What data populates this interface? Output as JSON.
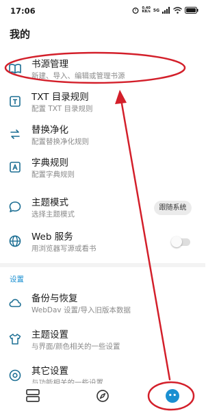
{
  "status_bar": {
    "time": "17:06",
    "net_speed_value": "0.40",
    "net_speed_unit": "KB/s",
    "signal_label": "5G"
  },
  "page": {
    "title": "我的"
  },
  "items": [
    {
      "title": "书源管理",
      "subtitle": "新建、导入、编辑或管理书源",
      "icon": "book-icon"
    },
    {
      "title": "TXT 目录规则",
      "subtitle": "配置 TXT 目录规则",
      "icon": "t-box-icon"
    },
    {
      "title": "替换净化",
      "subtitle": "配置替换净化规则",
      "icon": "swap-icon"
    },
    {
      "title": "字典规则",
      "subtitle": "配置字典规则",
      "icon": "a-box-icon"
    },
    {
      "title": "主题模式",
      "subtitle": "选择主题模式",
      "icon": "speech-bubble-icon",
      "button_label": "跟随系统"
    },
    {
      "title": "Web 服务",
      "subtitle": "用浏览器写源或看书",
      "icon": "globe-icon",
      "toggle_on": false
    }
  ],
  "settings_section": {
    "label": "设置",
    "items": [
      {
        "title": "备份与恢复",
        "subtitle": "WebDav 设置/导入旧版本数据",
        "icon": "cloud-icon"
      },
      {
        "title": "主题设置",
        "subtitle": "与界面/颜色相关的一些设置",
        "icon": "tshirt-icon"
      },
      {
        "title": "其它设置",
        "subtitle": "与功能相关的一些设置",
        "icon": "eye-icon"
      }
    ]
  },
  "bottom_nav": {
    "items": [
      {
        "icon": "bookshelf-icon",
        "active": false
      },
      {
        "icon": "compass-icon",
        "active": false
      },
      {
        "icon": "profile-icon",
        "active": true
      }
    ]
  },
  "colors": {
    "accent": "#1a8fd1",
    "icon": "#1c6e93",
    "annotation": "#d31f2a",
    "text_primary": "#1a1a1a",
    "text_secondary": "#8a8a8a"
  }
}
